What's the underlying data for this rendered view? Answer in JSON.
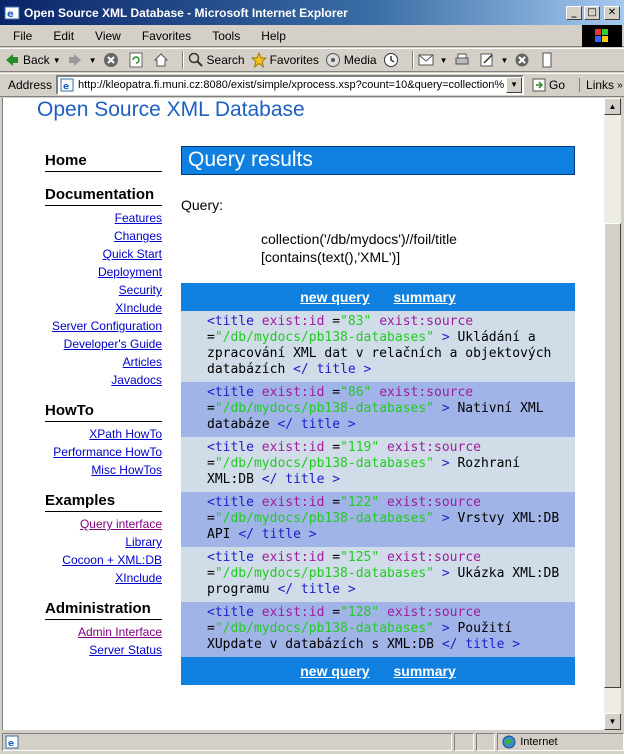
{
  "window": {
    "title": "Open Source XML Database - Microsoft Internet Explorer",
    "minimize": "_",
    "maximize": "□",
    "close": "✕"
  },
  "menu": [
    "File",
    "Edit",
    "View",
    "Favorites",
    "Tools",
    "Help"
  ],
  "toolbar": {
    "back": "Back",
    "search": "Search",
    "favorites": "Favorites",
    "media": "Media"
  },
  "address": {
    "label": "Address",
    "url": "http://kleopatra.fi.muni.cz:8080/exist/simple/xprocess.xsp?count=10&query=collection%",
    "go": "Go",
    "links": "Links"
  },
  "page": {
    "site_title": "Open Source XML Database",
    "header": "Query results",
    "query_label": "Query:",
    "query_text": "collection('/db/mydocs')//foil/title [contains(text(),'XML')]",
    "nav": {
      "new_query": "new query",
      "summary": "summary"
    }
  },
  "sidebar": {
    "home": "Home",
    "documentation": {
      "title": "Documentation",
      "links": [
        "Features",
        "Changes",
        "Quick Start",
        "Deployment",
        "Security",
        "XInclude",
        "Server Configuration",
        "Developer's Guide",
        "Articles",
        "Javadocs"
      ]
    },
    "howto": {
      "title": "HowTo",
      "links": [
        "XPath HowTo",
        "Performance HowTo",
        "Misc HowTos"
      ]
    },
    "examples": {
      "title": "Examples",
      "links": [
        "Query interface",
        "Library",
        "Cocoon + XML:DB",
        "XInclude"
      ]
    },
    "administration": {
      "title": "Administration",
      "links": [
        "Admin Interface",
        "Server Status"
      ]
    }
  },
  "results": {
    "tag_open": "<title",
    "attr_id": "exist:id",
    "attr_source": "exist:source",
    "eq": "=",
    "gt": ">",
    "tag_close": "</ title >",
    "source": "\"/db/mydocs/pb138-databases\"",
    "rows": [
      {
        "id": "\"83\"",
        "text": "Ukládání a zpracování XML dat v relačních a objektových databázích"
      },
      {
        "id": "\"86\"",
        "text": "Nativní XML databáze"
      },
      {
        "id": "\"119\"",
        "text": "Rozhraní XML:DB"
      },
      {
        "id": "\"122\"",
        "text": "Vrstvy XML:DB API"
      },
      {
        "id": "\"125\"",
        "text": "Ukázka XML:DB programu"
      },
      {
        "id": "\"128\"",
        "text": "Použití XUpdate v databázích s XML:DB"
      }
    ]
  },
  "status": {
    "zone": "Internet"
  }
}
